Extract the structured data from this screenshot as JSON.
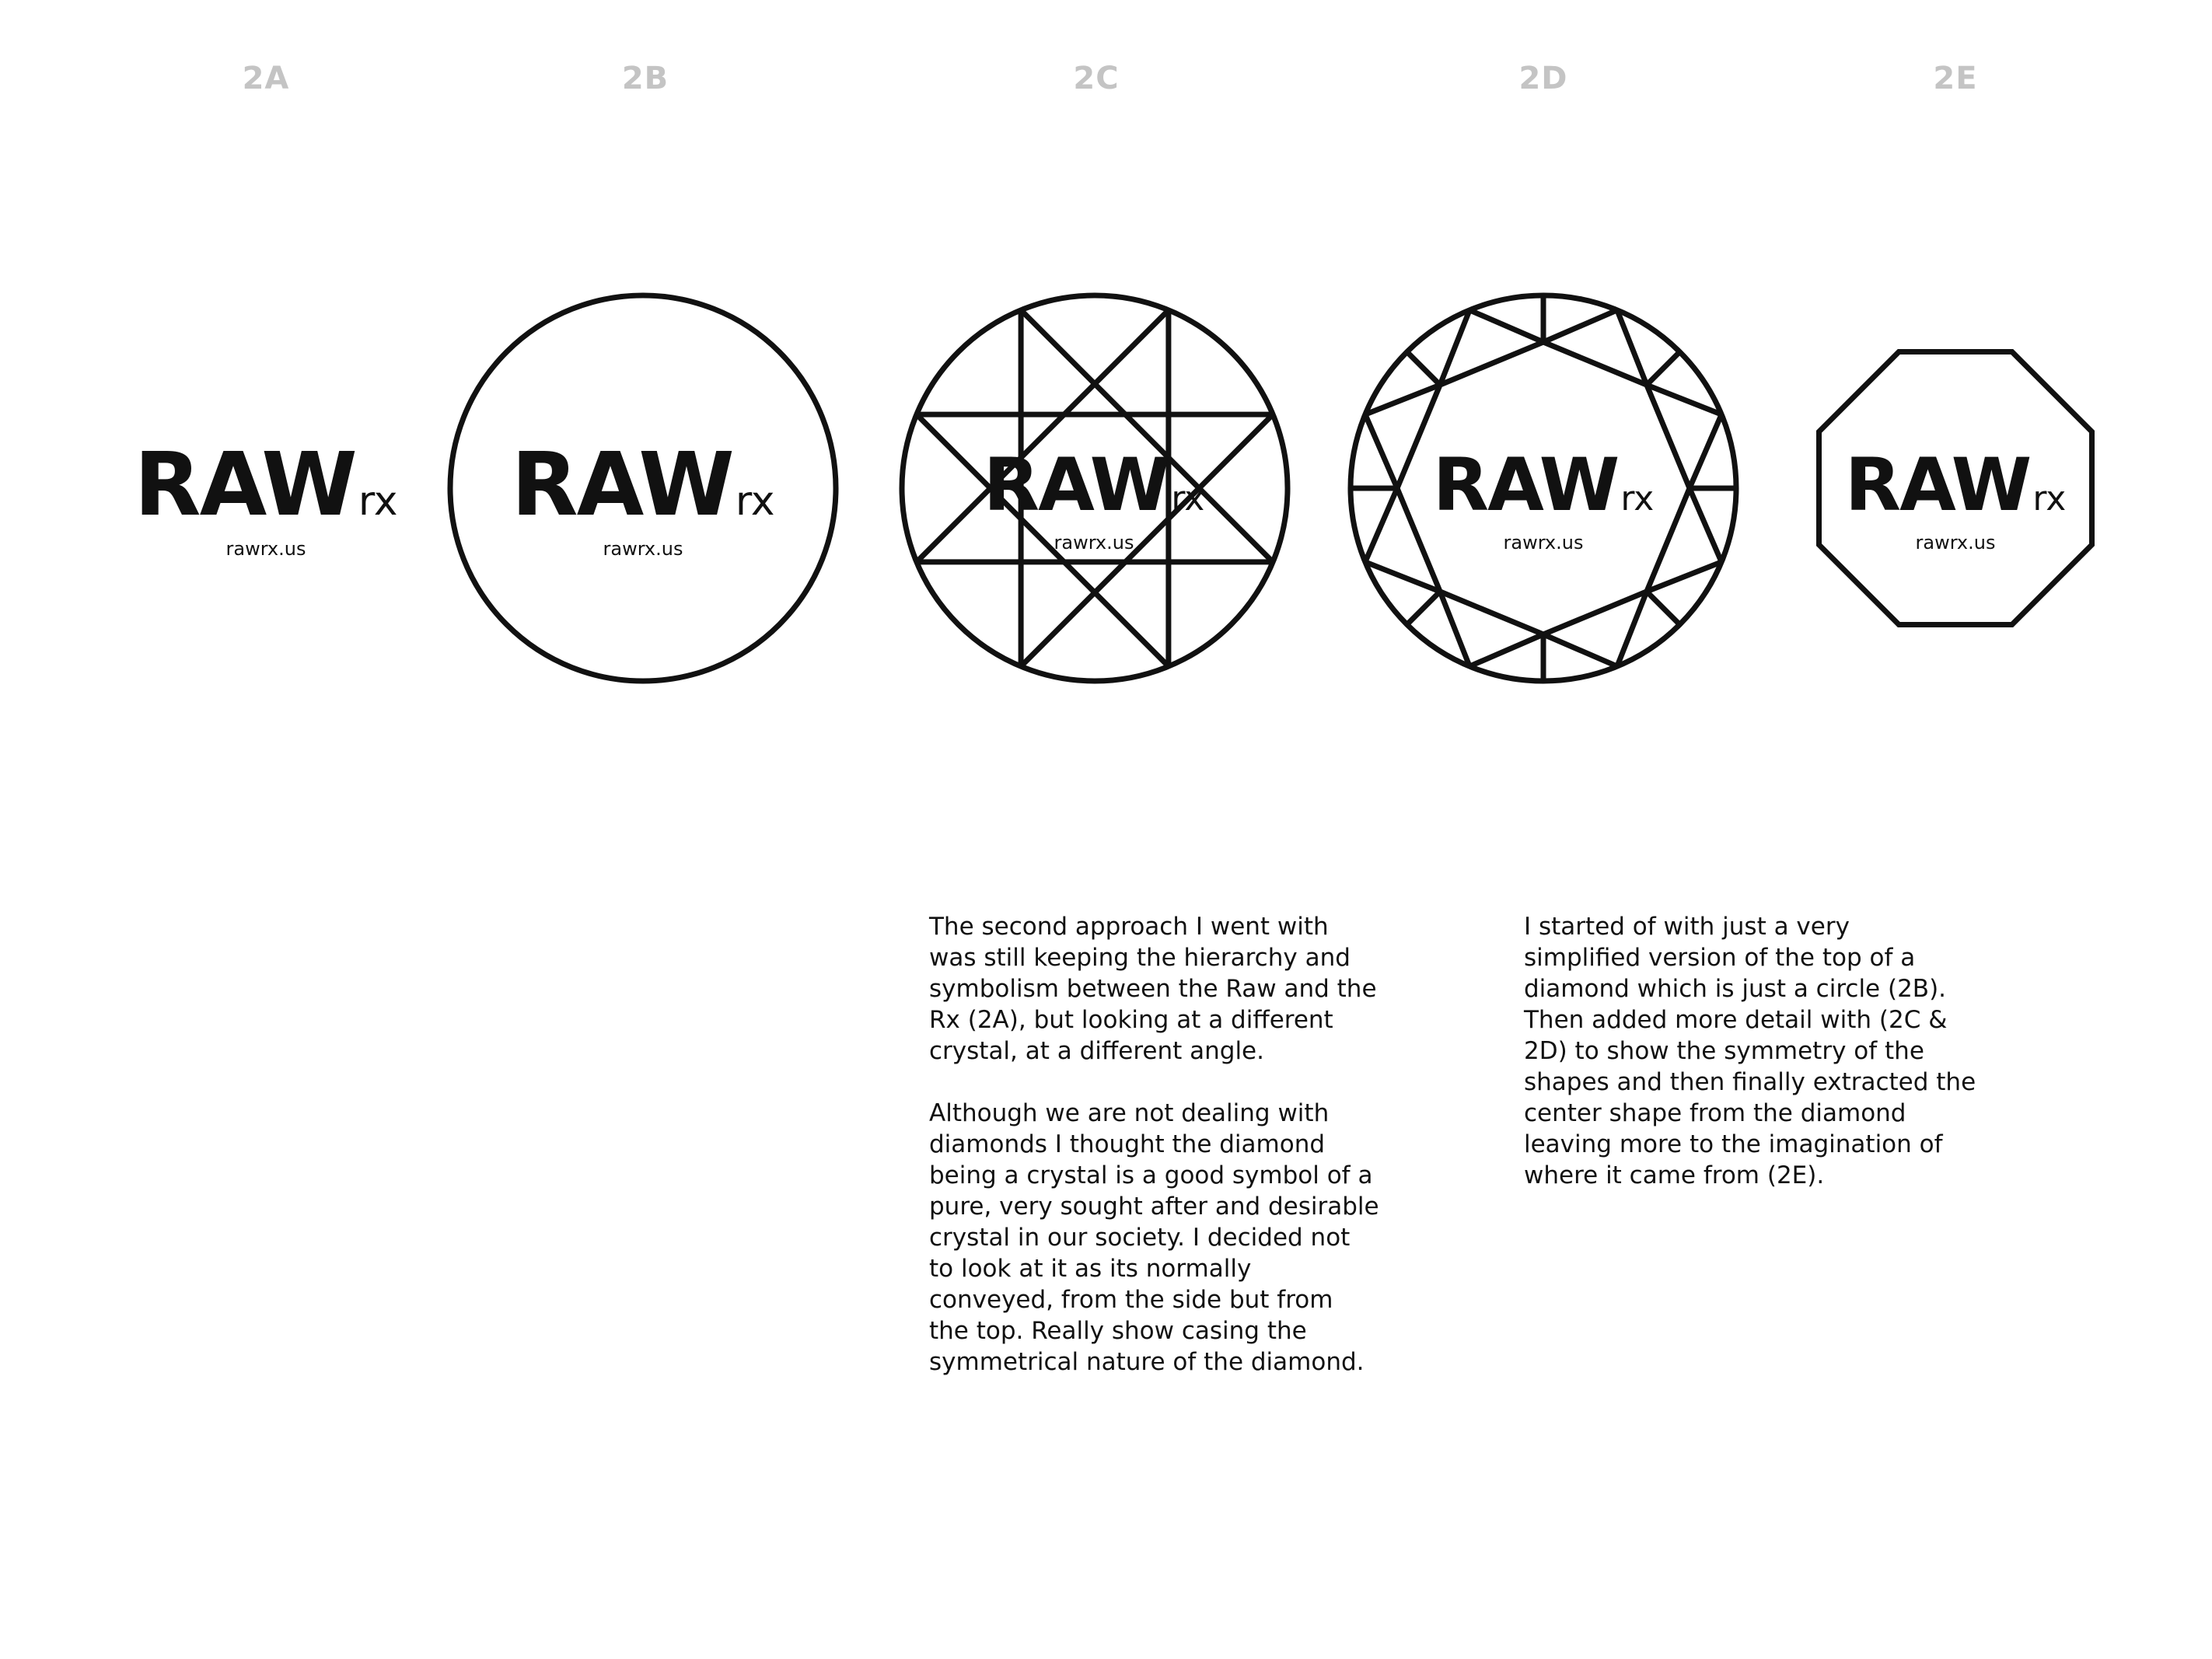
{
  "variants": [
    {
      "id": "2A",
      "frame": "none",
      "wordmark": "RAW",
      "suffix": "rx",
      "url": "rawrx.us"
    },
    {
      "id": "2B",
      "frame": "circle",
      "wordmark": "RAW",
      "suffix": "rx",
      "url": "rawrx.us"
    },
    {
      "id": "2C",
      "frame": "diamond-star",
      "wordmark": "RAW",
      "suffix": "rx",
      "url": "rawrx.us"
    },
    {
      "id": "2D",
      "frame": "diamond-detailed",
      "wordmark": "RAW",
      "suffix": "rx",
      "url": "rawrx.us"
    },
    {
      "id": "2E",
      "frame": "octagon",
      "wordmark": "RAW",
      "suffix": "rx",
      "url": "rawrx.us"
    }
  ],
  "text": {
    "left_paragraphs": [
      "The second approach I went with\nwas still keeping the hierarchy and\nsymbolism between the Raw and the\nRx (2A), but looking at a different\ncrystal, at a different angle.",
      "Although we are not dealing with\ndiamonds I thought the diamond\nbeing a crystal is a good symbol of a\npure, very sought after and desirable\ncrystal in our society. I decided not\nto look at it as its normally\nconveyed, from the side but from\nthe top. Really show casing the\nsymmetrical nature of the diamond."
    ],
    "right_paragraphs": [
      "I started of with just a very\nsimplified version of the top of a\ndiamond which is just a circle (2B).\nThen added more detail with (2C &\n2D) to show the symmetry of the\nshapes and then finally extracted the\ncenter shape from the diamond\nleaving more to the imagination of\nwhere it came from (2E)."
    ]
  },
  "colors": {
    "ink": "#111111",
    "label": "#c4c4c4",
    "background": "#ffffff"
  }
}
